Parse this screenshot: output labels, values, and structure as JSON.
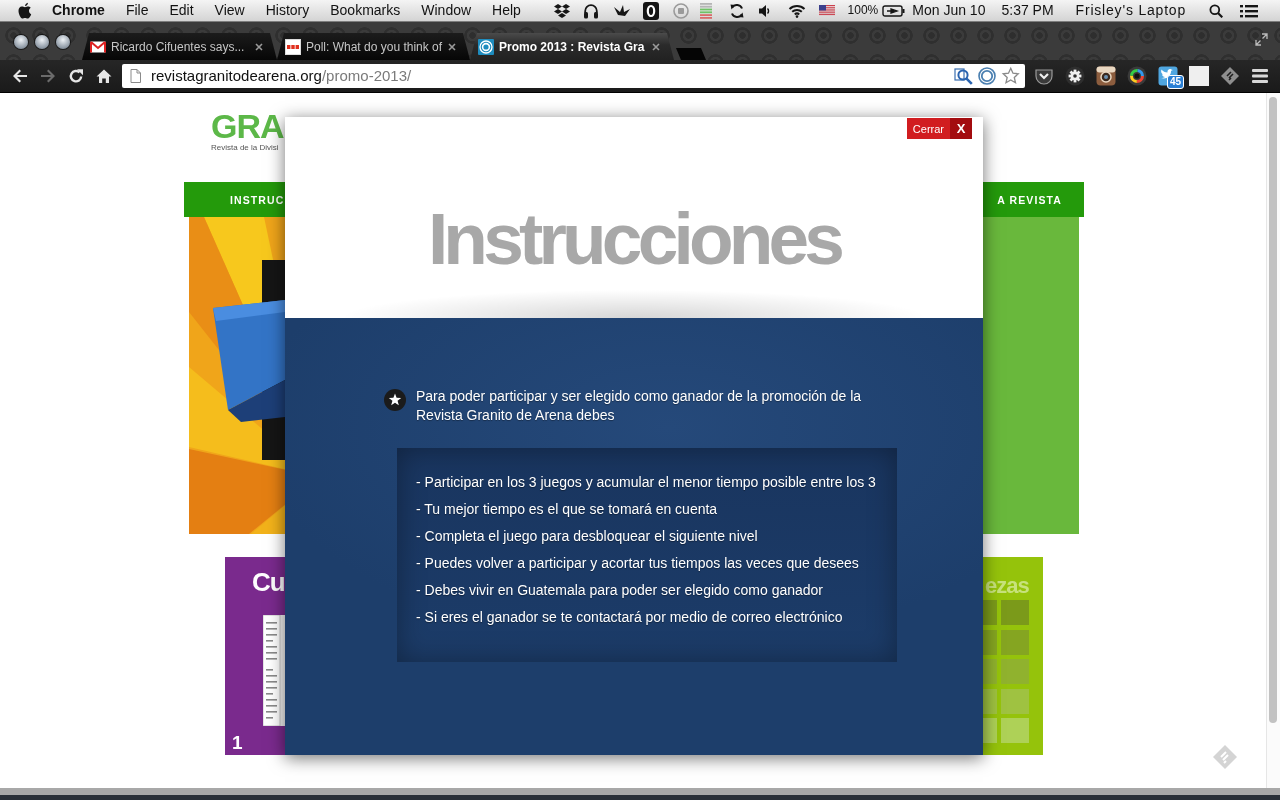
{
  "menu_bar": {
    "app": "Chrome",
    "menus": [
      "File",
      "Edit",
      "View",
      "History",
      "Bookmarks",
      "Window",
      "Help"
    ],
    "battery": "100%",
    "date": "Mon Jun 10",
    "time": "5:37 PM",
    "user": "Frisley's Laptop"
  },
  "tabs": [
    {
      "kind": "mail",
      "title": "Ricardo Cifuentes says...",
      "selected": false
    },
    {
      "kind": "news",
      "title": "Poll: What do you think of",
      "selected": false
    },
    {
      "kind": "blog",
      "title": "Promo 2013 : Revista Gra",
      "selected": true
    }
  ],
  "toolbar": {
    "forward_disabled": true,
    "url_host": "revistagranitodearena.org",
    "url_path": "/promo-2013/",
    "bookmarked": false,
    "notification_count": "45"
  },
  "page": {
    "logo": "GRA",
    "tagline": "Revista de la Divisi",
    "nav_left": "INSTRUC",
    "nav_right": "A REVISTA",
    "cards": [
      {
        "kind": "reading",
        "title": "Cu",
        "number": "1"
      },
      {
        "kind": "puzzle",
        "title": "ezas"
      }
    ]
  },
  "modal": {
    "title": "Instrucciones",
    "close_label": "Cerrar",
    "close_icon": "X",
    "intro": "Para poder participar y ser elegido como ganador de la promoción de la Revista Granito de Arena debes",
    "rules": [
      "- Participar en los 3 juegos y acumular el menor tiempo posible entre los 3",
      "- Tu mejor tiempo es el que se tomará en cuenta",
      "- Completa el juego para desbloquear el siguiente nivel",
      "- Puedes volver a participar y acortar tus tiempos las veces que desees",
      "- Debes vivir en Guatemala para poder ser elegido como ganador",
      "- Si eres el ganador se te contactará por medio de correo electrónico"
    ]
  }
}
